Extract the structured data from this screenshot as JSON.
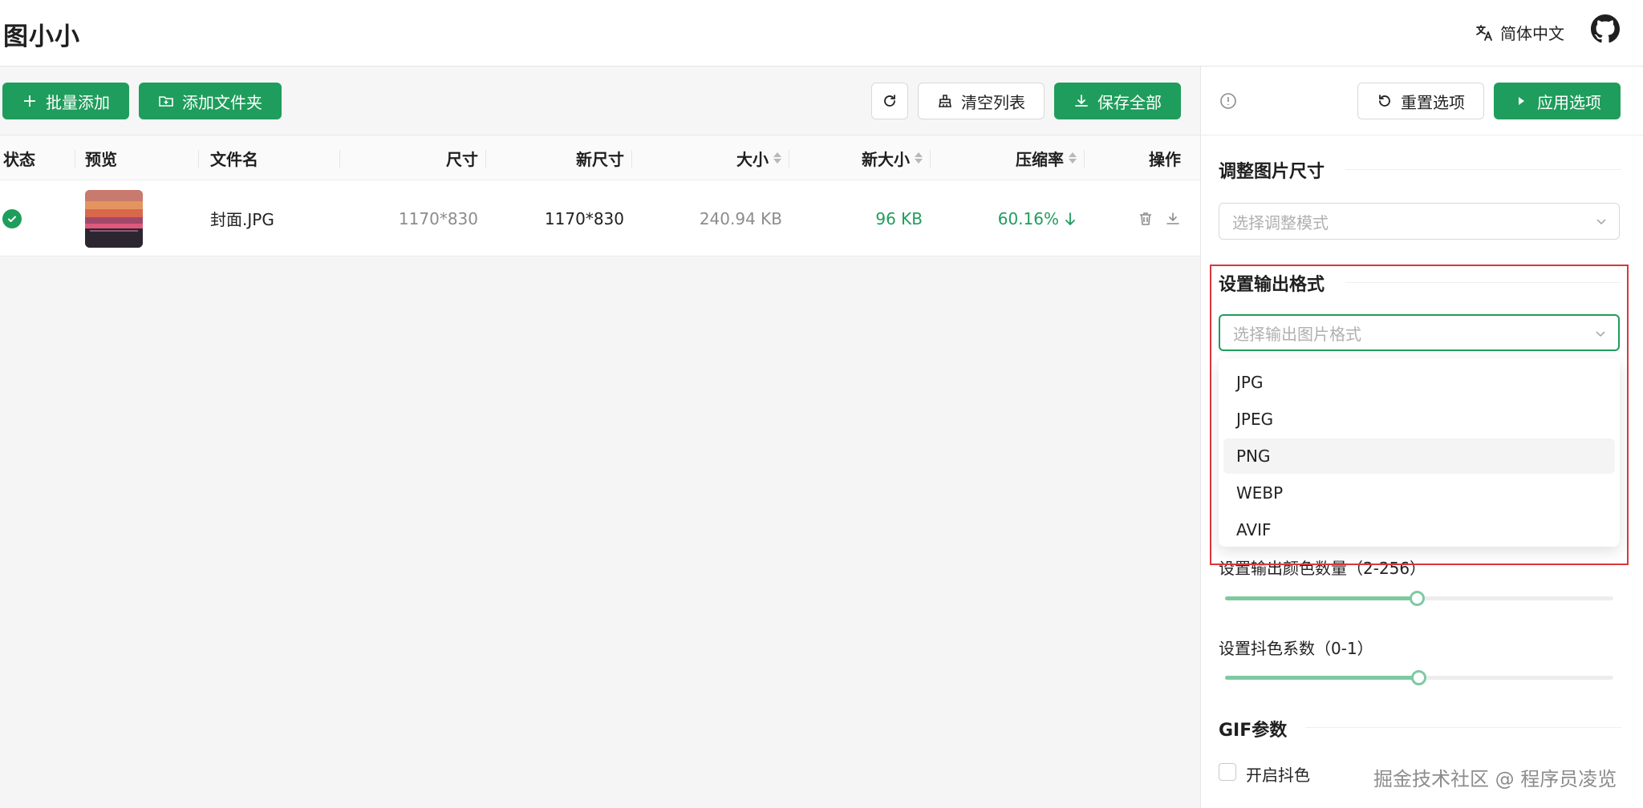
{
  "header": {
    "logo": "图小小",
    "language_label": "简体中文"
  },
  "toolbar": {
    "batch_add_label": "批量添加",
    "add_folder_label": "添加文件夹",
    "clear_list_label": "清空列表",
    "save_all_label": "保存全部"
  },
  "table": {
    "columns": {
      "status": "状态",
      "preview": "预览",
      "filename": "文件名",
      "dimensions": "尺寸",
      "new_dimensions": "新尺寸",
      "size": "大小",
      "new_size": "新大小",
      "ratio": "压缩率",
      "actions": "操作"
    },
    "rows": [
      {
        "filename": "封面.JPG",
        "dimensions": "1170*830",
        "new_dimensions": "1170*830",
        "size": "240.94 KB",
        "new_size": "96 KB",
        "ratio": "60.16%",
        "status": "done"
      }
    ]
  },
  "panel": {
    "reset_label": "重置选项",
    "apply_label": "应用选项",
    "resize_title": "调整图片尺寸",
    "resize_placeholder": "选择调整模式",
    "format_title": "设置输出格式",
    "format_placeholder": "选择输出图片格式",
    "format_options": [
      "JPG",
      "JPEG",
      "PNG",
      "WEBP",
      "AVIF"
    ],
    "hovered_option": "PNG",
    "colors_label": "设置输出颜色数量（2-256）",
    "colors_level": 0.49,
    "dither_label": "设置抖色系数（0-1）",
    "dither_level": 0.5,
    "gif_title": "GIF参数",
    "gif_dither_label": "开启抖色"
  },
  "watermark": "掘金技术社区 @ 程序员凌览",
  "colors": {
    "primary": "#1f9d5c",
    "success_text": "#1f9d5c",
    "highlight": "#d9363e"
  }
}
